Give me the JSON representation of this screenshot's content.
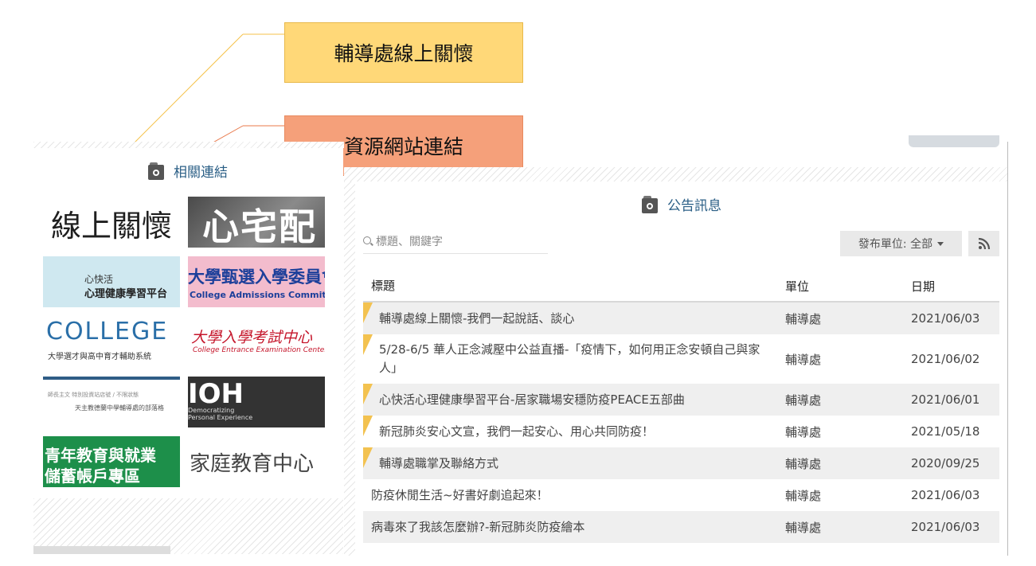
{
  "callouts": {
    "online_care": "輔導處線上關懷",
    "resource_links": "資源網站連結"
  },
  "related_links": {
    "title": "相關連結",
    "tiles": {
      "online_care": "線上關懷",
      "home_delivery": "心宅配",
      "happy_heart_line1": "心快活",
      "happy_heart_line2": "心理健康學習平台",
      "admissions_line1": "大學甄選入學委員會",
      "admissions_line2": "College Admissions Committee",
      "college_logo": "COLLEGE",
      "college_line": "大學選才與高中育才輔助系統",
      "exam_center_line1": "大學入學考試中心",
      "exam_center_line2": "College Entrance Examination Center",
      "tile7_line1": "師長主文  特別投資站店號 / 不限狀態",
      "tile7_line2": "天主教德蘭中學輔導處的部落格",
      "ioh_line1": "IOH",
      "ioh_line2": "Democratizing",
      "ioh_line3": "Personal Experience",
      "youth_line1": "青年教育與就業",
      "youth_line2": "儲蓄帳戶專區",
      "family_center": "家庭教育中心"
    }
  },
  "announcements": {
    "title": "公告訊息",
    "search_placeholder": "標題、關鍵字",
    "filter_label": "發布單位: 全部",
    "columns": {
      "title": "標題",
      "unit": "單位",
      "date": "日期"
    },
    "rows": [
      {
        "title": "輔導處線上關懷-我們一起說話、談心",
        "unit": "輔導處",
        "date": "2021/06/03",
        "pinned": true
      },
      {
        "title": "5/28-6/5 華人正念減壓中公益直播-「疫情下，如何用正念安頓自己與家人」",
        "unit": "輔導處",
        "date": "2021/06/02",
        "pinned": true
      },
      {
        "title": "心快活心理健康學習平台-居家職場安穩防疫PEACE五部曲",
        "unit": "輔導處",
        "date": "2021/06/01",
        "pinned": true
      },
      {
        "title": "新冠肺炎安心文宣，我們一起安心、用心共同防疫！",
        "unit": "輔導處",
        "date": "2021/05/18",
        "pinned": true
      },
      {
        "title": "輔導處職掌及聯絡方式",
        "unit": "輔導處",
        "date": "2020/09/25",
        "pinned": true
      },
      {
        "title": "防疫休閒生活~好書好劇追起來！",
        "unit": "輔導處",
        "date": "2021/06/03",
        "pinned": false
      },
      {
        "title": "病毒來了我該怎麼辦?-新冠肺炎防疫繪本",
        "unit": "輔導處",
        "date": "2021/06/03",
        "pinned": false
      }
    ]
  },
  "colors": {
    "callout_yellow": "#ffd878",
    "callout_orange": "#f5a07a",
    "link_blue": "#2b5f86",
    "pin_yellow": "#f3c250"
  }
}
